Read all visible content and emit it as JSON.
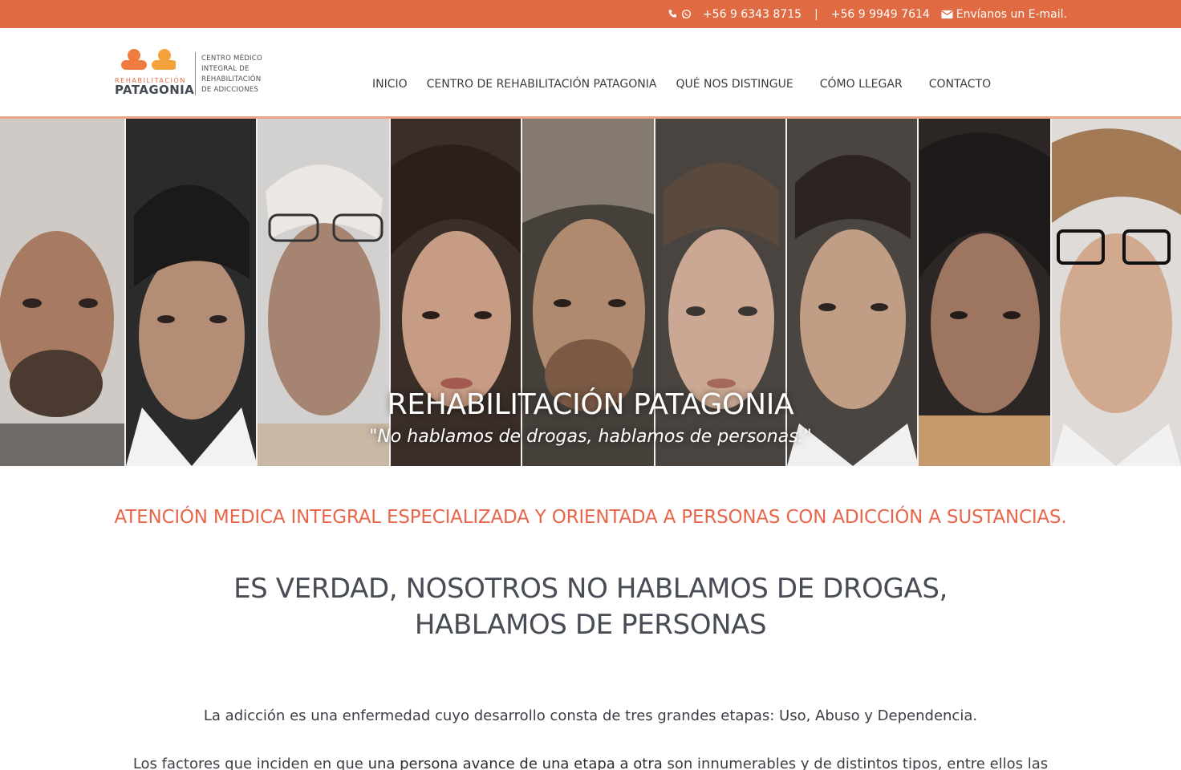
{
  "colors": {
    "accent": "#e06a42",
    "tagline": "#e8664a",
    "headline": "#484d55"
  },
  "topbar": {
    "phone_icon": "phone-icon",
    "whatsapp_icon": "whatsapp-icon",
    "phone_1": "+56 9 6343 8715",
    "separator": "|",
    "phone_2": "+56 9 9949 7614",
    "mail_icon": "envelope-icon",
    "email_label": "Envíanos un E-mail."
  },
  "logo": {
    "word_top": "REHABILITACIÓN",
    "word_main": "PATAGONIA",
    "desc_lines": [
      "CENTRO MÉDICO",
      "INTEGRAL DE",
      "REHABILITACIÓN",
      "DE ADICCIONES"
    ]
  },
  "nav": {
    "items": [
      {
        "label": "INICIO"
      },
      {
        "label": "CENTRO DE REHABILITACIÓN PATAGONIA"
      },
      {
        "label": "QUÉ NOS DISTINGUE"
      },
      {
        "label": "CÓMO LLEGAR"
      },
      {
        "label": "CONTACTO"
      }
    ]
  },
  "hero": {
    "title": "REHABILITACIÓN PATAGONIA",
    "quote": "\"No hablamos de drogas, hablamos de personas.\""
  },
  "content": {
    "tagline": "ATENCIÓN MEDICA INTEGRAL ESPECIALIZADA Y ORIENTADA A PERSONAS CON ADICCIÓN A SUSTANCIAS.",
    "headline_line1": "ES VERDAD, NOSOTROS NO HABLAMOS DE DROGAS,",
    "headline_line2": "HABLAMOS DE PERSONAS",
    "paragraph_1": "La adicción es una enfermedad cuyo desarrollo consta de tres grandes etapas: Uso, Abuso y Dependencia.",
    "paragraph_2_a": "Los factores que inciden en que ",
    "paragraph_2_b": "una persona avance de una etapa a otra",
    "paragraph_2_c": " son innumerables y de distintos tipos, entre ellos las"
  }
}
